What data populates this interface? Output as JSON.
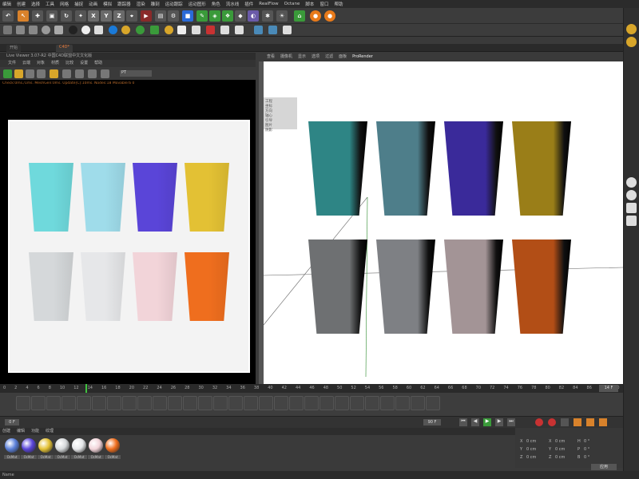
{
  "menu": [
    "编辑",
    "创建",
    "选择",
    "工具",
    "网格",
    "捕捉",
    "动画",
    "模拟",
    "跟踪器",
    "渲染",
    "雕刻",
    "运动跟踪",
    "运动图形",
    "角色",
    "流水线",
    "插件",
    "RealFlow",
    "Octane",
    "脚本",
    "窗口",
    "帮助"
  ],
  "tabs": [
    "开始",
    "C4D*"
  ],
  "live_viewer": {
    "title": "Live Viewer 3.07-R2 中国C4D联盟中文文化版",
    "menu": [
      "文件",
      "云端",
      "对象",
      "材质",
      "比较",
      "设置",
      "帮助"
    ],
    "status": "Check:0ms./1ms. MeshGen:0ms. Update[C]:10ms. Nodes:18 Movable:6 0",
    "mode_value": "PT",
    "gpu_info": [
      "eForce GTX 1080 Ti[7]6.1] 9/85 60°C",
      "Out-of-core used/max:0Kb/4Gb",
      "Grey8/16: 0/0      Rgb32/64: 0/0",
      "Used/free/total vram: 289Mb/6.2155b/11"
    ],
    "render_stats": "Rendering: 100%  Ms/sec: 0  Time: 00:00:01/00:00:01  Spp/maxspp: 3800/3800  Tri: 0/45k  Mesh: 10  Hair: 0",
    "progress": 1
  },
  "viewport": {
    "menu": [
      "查看",
      "摄像机",
      "显示",
      "选项",
      "过滤",
      "面板"
    ],
    "renderer": "ProRender",
    "hud": [
      "工程",
      "坐标",
      "方向",
      "轴心",
      "引导",
      "图片",
      "阴影"
    ]
  },
  "render_cups": [
    {
      "color": "#6fd9dc"
    },
    {
      "color": "#9fdcea"
    },
    {
      "color": "#5a45d8"
    },
    {
      "color": "#e3c134"
    },
    {
      "color": "#d5d8da"
    },
    {
      "color": "#e6e7e9"
    },
    {
      "color": "#f2d4d9"
    },
    {
      "color": "#ef6e1e"
    }
  ],
  "viewport_cups": [
    {
      "color": "#2e8585"
    },
    {
      "color": "#4e7e8a"
    },
    {
      "color": "#3a2a9a"
    },
    {
      "color": "#9a7e18"
    },
    {
      "color": "#6e7072"
    },
    {
      "color": "#7e8084"
    },
    {
      "color": "#a39496"
    },
    {
      "color": "#b24e16"
    }
  ],
  "timeline": {
    "ticks": [
      "0",
      "2",
      "4",
      "6",
      "8",
      "10",
      "12",
      "14",
      "16",
      "18",
      "20",
      "22",
      "24",
      "26",
      "28",
      "30",
      "32",
      "34",
      "36",
      "38",
      "40",
      "42",
      "44",
      "46",
      "48",
      "50",
      "52",
      "54",
      "56",
      "58",
      "60",
      "62",
      "64",
      "66",
      "68",
      "70",
      "72",
      "74",
      "76",
      "78",
      "80",
      "82",
      "84",
      "86",
      "88",
      "90"
    ],
    "current": "14",
    "end_frame": "14 F",
    "frame_field": "0 F",
    "max_field": "90 F"
  },
  "materials": {
    "menu": [
      "创建",
      "编辑",
      "功能",
      "纹理"
    ],
    "items": [
      {
        "label": "OcMat",
        "color": "#5a7fd8"
      },
      {
        "label": "OcMat",
        "color": "#5a45d8"
      },
      {
        "label": "OcMat",
        "color": "#e3c134"
      },
      {
        "label": "OcMat",
        "color": "#d5d8da"
      },
      {
        "label": "OcMat",
        "color": "#e6e7e9"
      },
      {
        "label": "OcMat",
        "color": "#f2d4d9"
      },
      {
        "label": "OcMat",
        "color": "#ef6e1e"
      }
    ]
  },
  "coords": {
    "rows": [
      {
        "a": "X",
        "av": "0 cm",
        "b": "X",
        "bv": "0 cm",
        "c": "H",
        "cv": "0 °"
      },
      {
        "a": "Y",
        "av": "0 cm",
        "b": "Y",
        "bv": "0 cm",
        "c": "P",
        "cv": "0 °"
      },
      {
        "a": "Z",
        "av": "0 cm",
        "b": "Z",
        "bv": "0 cm",
        "c": "B",
        "cv": "0 °"
      }
    ],
    "apply": "应用"
  },
  "status": "Name"
}
